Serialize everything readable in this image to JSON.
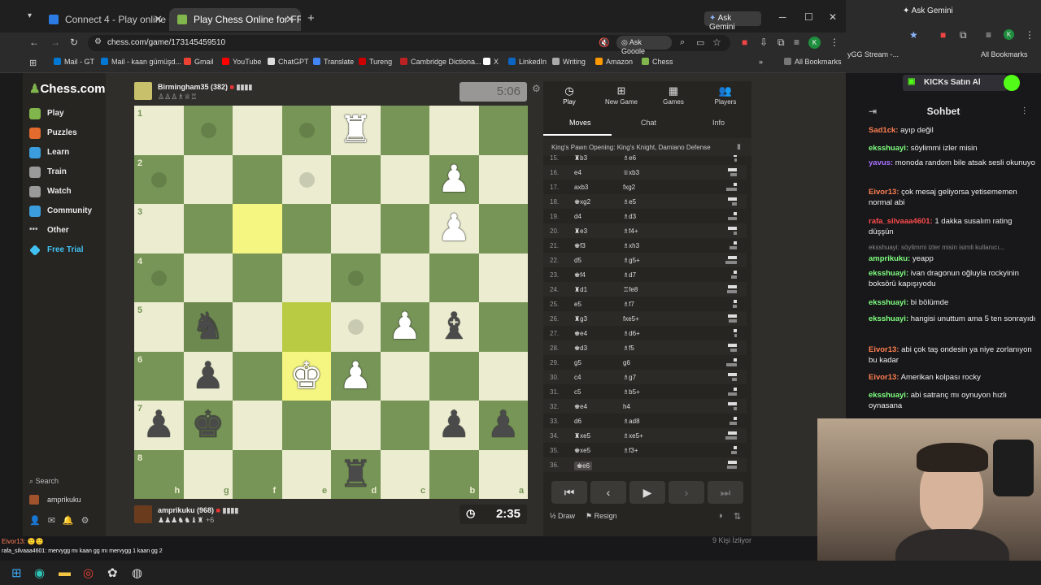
{
  "browser": {
    "tabs": [
      {
        "label": "Connect 4 - Play online game ..."
      },
      {
        "label": "Play Chess Online for FREE - 2 ..."
      }
    ],
    "ask_gemini": "Ask Gemini",
    "url": "chess.com/game/173145459510",
    "ask_google": "Ask Google",
    "bookmarks": [
      "Mail - GT",
      "Mail - kaan gümüşd...",
      "Gmail",
      "YouTube",
      "ChatGPT",
      "Translate",
      "Tureng",
      "Cambridge Dictiona...",
      "X",
      "LinkedIn",
      "Writing",
      "Amazon",
      "Chess"
    ],
    "all_bookmarks": "All Bookmarks",
    "right_bookmark": "yGG Stream -...",
    "right_all_bookmarks": "All Bookmarks"
  },
  "sidebar": {
    "logo": "Chess.com",
    "items": [
      {
        "label": "Play",
        "icon": "pawn-icon",
        "color": "#81b64c"
      },
      {
        "label": "Puzzles",
        "icon": "puzzle-icon",
        "color": "#e36b2d"
      },
      {
        "label": "Learn",
        "icon": "learn-icon",
        "color": "#3b9ddd"
      },
      {
        "label": "Train",
        "icon": "train-icon",
        "color": "#9a9a9a"
      },
      {
        "label": "Watch",
        "icon": "watch-icon",
        "color": "#9a9a9a"
      },
      {
        "label": "Community",
        "icon": "community-icon",
        "color": "#3b9ddd"
      },
      {
        "label": "Other",
        "icon": "more-icon",
        "color": "#9a9a9a"
      },
      {
        "label": "Free Trial",
        "icon": "diamond-icon",
        "color": "#41c1f2"
      }
    ],
    "search": "Search",
    "username": "amprikuku"
  },
  "game": {
    "top_player": {
      "name": "Birmingham35 (382)",
      "clock": "5:06"
    },
    "bottom_player": {
      "name": "amprikuku (968)",
      "clock": "2:35",
      "material": "+6"
    },
    "ranks": [
      "1",
      "2",
      "3",
      "4",
      "5",
      "6",
      "7",
      "8"
    ],
    "files": [
      "h",
      "g",
      "f",
      "e",
      "d",
      "c",
      "b",
      "a"
    ]
  },
  "panel": {
    "tabs": [
      {
        "label": "Play",
        "icon": "stopwatch-icon"
      },
      {
        "label": "New Game",
        "icon": "plus-icon"
      },
      {
        "label": "Games",
        "icon": "board-icon"
      },
      {
        "label": "Players",
        "icon": "players-icon"
      }
    ],
    "subtabs": [
      "Moves",
      "Chat",
      "Info"
    ],
    "opening": "King's Pawn Opening: King's Knight, Damiano Defense",
    "moves": [
      {
        "n": "15.",
        "w": "♜b3",
        "b": "♗e6"
      },
      {
        "n": "16.",
        "w": "e4",
        "b": "♕xb3"
      },
      {
        "n": "17.",
        "w": "axb3",
        "b": "fxg2"
      },
      {
        "n": "18.",
        "w": "♚xg2",
        "b": "♗e5"
      },
      {
        "n": "19.",
        "w": "d4",
        "b": "♗d3"
      },
      {
        "n": "20.",
        "w": "♜e3",
        "b": "♗f4+"
      },
      {
        "n": "21.",
        "w": "♚f3",
        "b": "♗xh3"
      },
      {
        "n": "22.",
        "w": "d5",
        "b": "♗g5+"
      },
      {
        "n": "23.",
        "w": "♚f4",
        "b": "♗d7"
      },
      {
        "n": "24.",
        "w": "♜d1",
        "b": "♖fe8"
      },
      {
        "n": "25.",
        "w": "e5",
        "b": "♗f7"
      },
      {
        "n": "26.",
        "w": "♜g3",
        "b": "fxe5+"
      },
      {
        "n": "27.",
        "w": "♚e4",
        "b": "♗d6+"
      },
      {
        "n": "28.",
        "w": "♚d3",
        "b": "♗f5"
      },
      {
        "n": "29.",
        "w": "g5",
        "b": "g6"
      },
      {
        "n": "30.",
        "w": "c4",
        "b": "♗g7"
      },
      {
        "n": "31.",
        "w": "c5",
        "b": "♗b5+"
      },
      {
        "n": "32.",
        "w": "♚e4",
        "b": "h4"
      },
      {
        "n": "33.",
        "w": "d6",
        "b": "♗ad8"
      },
      {
        "n": "34.",
        "w": "♜xe5",
        "b": "♗xe5+"
      },
      {
        "n": "35.",
        "w": "♚xe5",
        "b": "♗f3+"
      },
      {
        "n": "36.",
        "w": "♚e6",
        "b": ""
      }
    ],
    "draw": "Draw",
    "resign": "Resign"
  },
  "chat": {
    "title": "Sohbet",
    "gemini_btn": "KICKs Satın Al",
    "messages": [
      {
        "user": "Sad1ck:",
        "text": " ayıp değil",
        "color": "#ff7f50"
      },
      {
        "user": "eksshuayi:",
        "text": " söylimmi izler misin",
        "color": "#7fff7f"
      },
      {
        "user": "yavus:",
        "text": " monoda random bile atsak sesli okunuyo",
        "color": "#a970ff"
      },
      {
        "user": "Eivor13:",
        "text": " çok mesaj geliyorsa yetisememen normal abi",
        "color": "#ff7f50"
      },
      {
        "user": "rafa_silvaaa4601:",
        "text": " 1 dakka susalım rating düşşün",
        "color": "#ff4b4b"
      },
      {
        "user": "",
        "text": "eksshuayi: söylimmi izler misin isimli kullanıcı...",
        "color": "#888"
      },
      {
        "user": "amprikuku:",
        "text": " yeapp",
        "color": "#7fff7f"
      },
      {
        "user": "eksshuayi:",
        "text": " ivan dragonun oğluyla rockyinin boksörü kapışıyodu",
        "color": "#7fff7f"
      },
      {
        "user": "eksshuayi:",
        "text": " bi bölümde",
        "color": "#7fff7f"
      },
      {
        "user": "eksshuayi:",
        "text": " hangisi unuttum ama 5 ten sonrayıdı",
        "color": "#7fff7f"
      },
      {
        "user": "Eivor13:",
        "text": " abi çok taş ondesin ya niye zorlanıyon bu kadar",
        "color": "#ff7f50"
      },
      {
        "user": "Eivor13:",
        "text": " Amerikan kolpası rocky",
        "color": "#ff7f50"
      },
      {
        "user": "eksshuayi:",
        "text": " abi satranç mı oynuyon hızlı oynasana",
        "color": "#7fff7f"
      }
    ]
  },
  "overlay": {
    "line1": "Eivor13: 🙂🙂",
    "line2": "rafa_silvaaa4601: mervygg mı kaan gg mı mervygg 1 kaan gg 2",
    "status": "9 Kişi İzliyor"
  }
}
